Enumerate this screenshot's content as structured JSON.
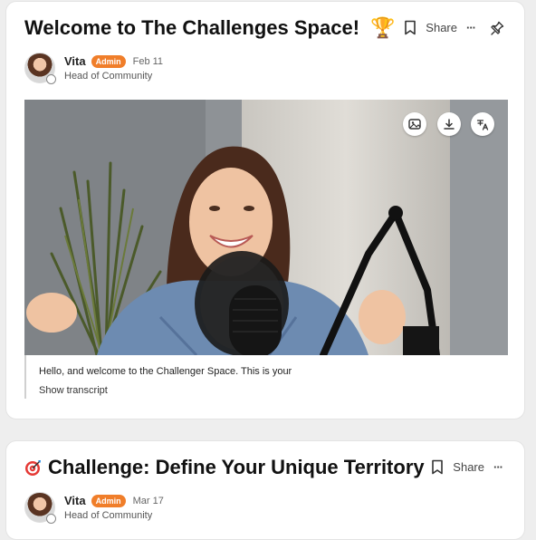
{
  "post1": {
    "title": "Welcome to The Challenges Space!",
    "title_emoji": "🏆",
    "share_label": "Share",
    "more_label": "···",
    "author": {
      "name": "Vita",
      "badge": "Admin",
      "date": "Feb 11",
      "role": "Head of Community"
    },
    "transcript_text": "Hello, and welcome to the Challenger Space. This is your",
    "transcript_toggle": "Show transcript",
    "video_buttons": [
      "image-icon",
      "download-icon",
      "translate-icon"
    ]
  },
  "post2": {
    "title": "Challenge: Define Your Unique Territory",
    "title_emoji": "target-icon",
    "share_label": "Share",
    "more_label": "···",
    "author": {
      "name": "Vita",
      "badge": "Admin",
      "date": "Mar 17",
      "role": "Head of Community"
    }
  },
  "colors": {
    "admin_badge": "#f07e2a",
    "card_bg": "#ffffff",
    "page_bg": "#eeeeee"
  }
}
